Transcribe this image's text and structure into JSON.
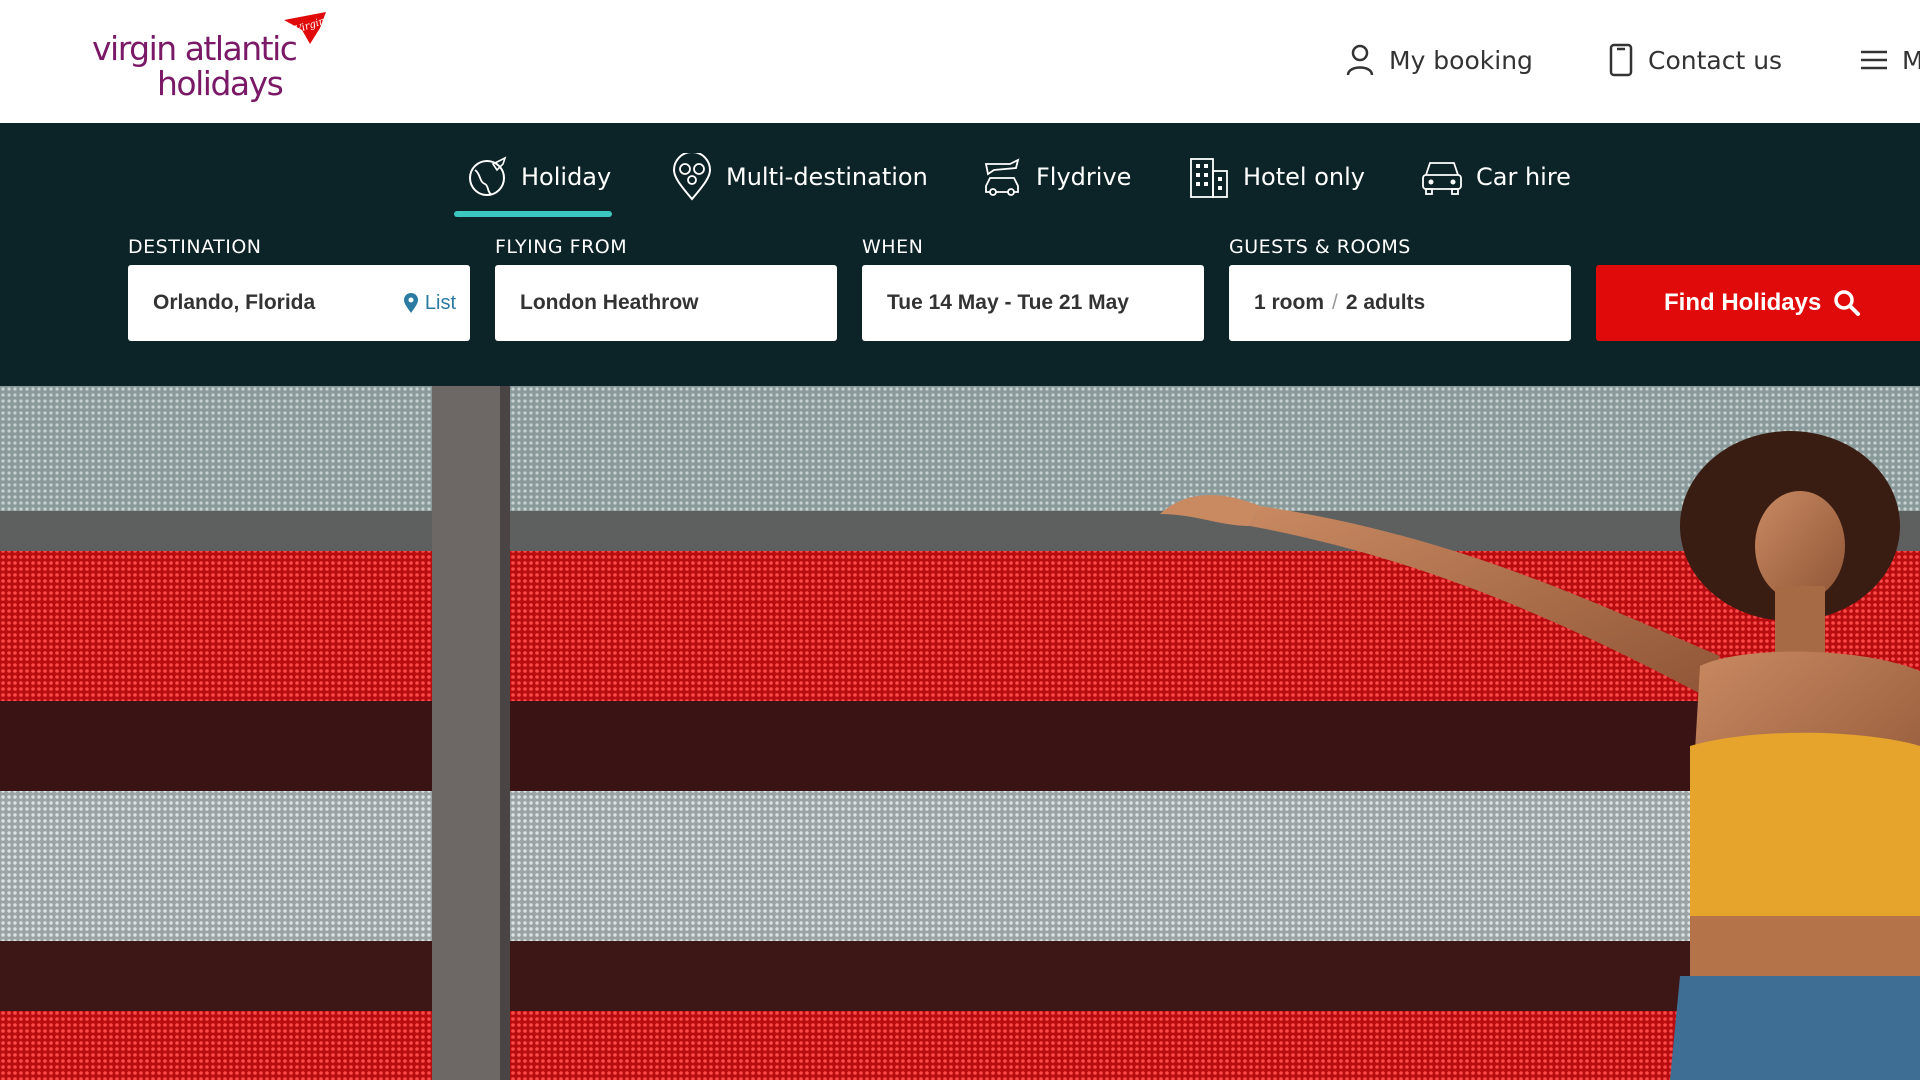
{
  "brand": {
    "line1": "virgin atlantic",
    "line2": "holidays",
    "badge_text": "Virgin",
    "color": "#7a1a67",
    "badge_color": "#e10a0a"
  },
  "header_nav": {
    "my_booking": "My booking",
    "contact_us": "Contact us",
    "menu": "M"
  },
  "tabs": [
    {
      "label": "Holiday",
      "icon": "globe-plane-icon",
      "active": true
    },
    {
      "label": "Multi-destination",
      "icon": "multi-pin-icon",
      "active": false
    },
    {
      "label": "Flydrive",
      "icon": "plane-car-icon",
      "active": false
    },
    {
      "label": "Hotel only",
      "icon": "hotel-icon",
      "active": false
    },
    {
      "label": "Car hire",
      "icon": "car-icon",
      "active": false
    }
  ],
  "search": {
    "destination": {
      "label": "DESTINATION",
      "value": "Orlando, Florida",
      "list_link": "List"
    },
    "flying_from": {
      "label": "FLYING FROM",
      "value": "London Heathrow"
    },
    "when": {
      "label": "WHEN",
      "value": "Tue 14 May - Tue 21 May"
    },
    "guests": {
      "label": "GUESTS & ROOMS",
      "rooms": "1 room",
      "separator": "/",
      "adults": "2 adults"
    },
    "submit_label": "Find Holidays"
  },
  "colors": {
    "panel_bg": "#0c2427",
    "accent_teal": "#3cc6c0",
    "cta_red": "#e10a0a",
    "link_blue": "#2a7aa1"
  },
  "hero": {
    "description_icon": "hero-image"
  }
}
